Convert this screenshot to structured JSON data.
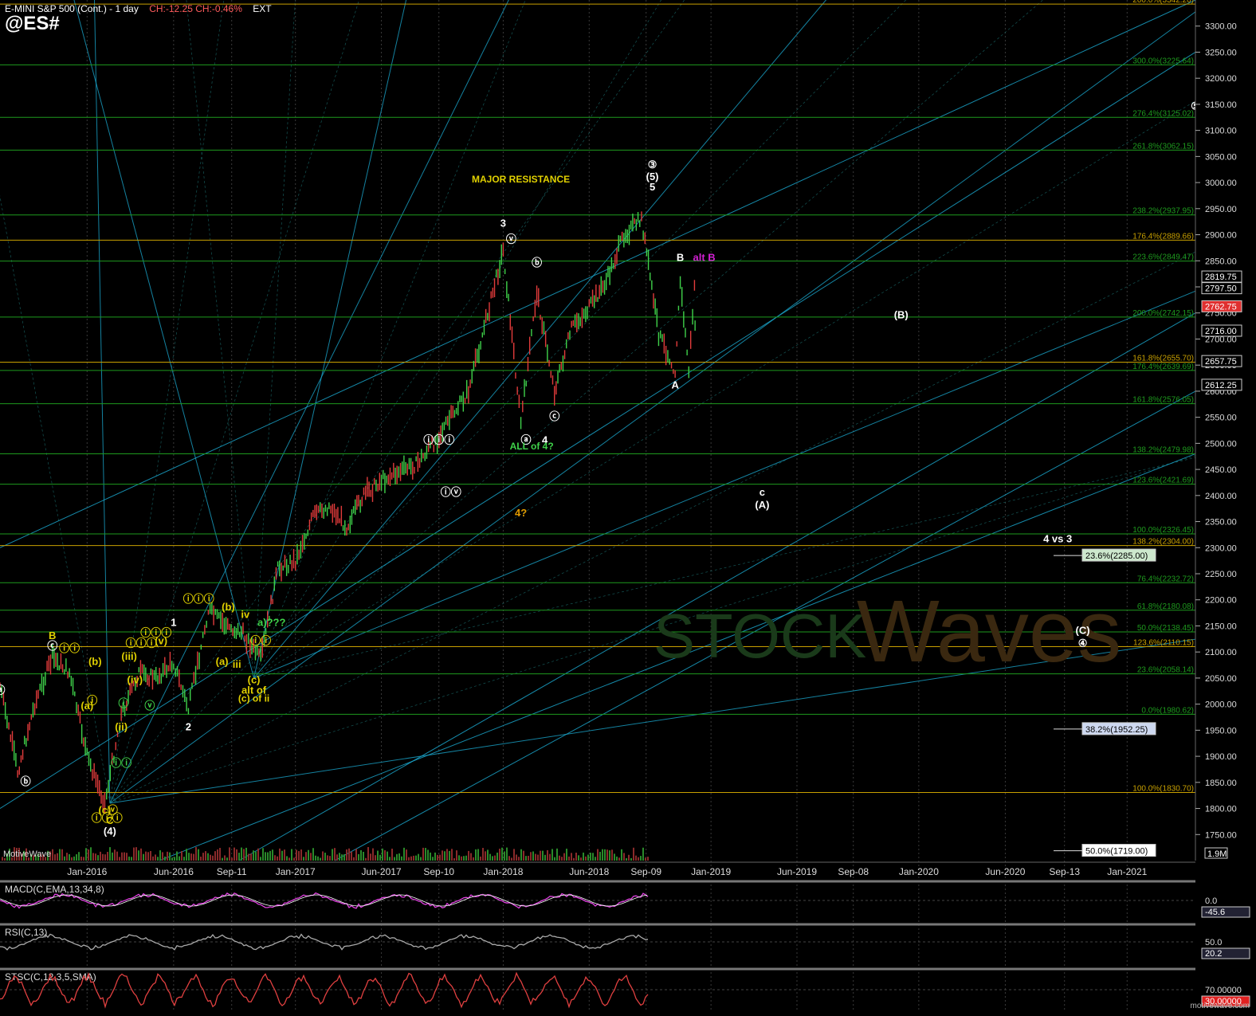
{
  "header": {
    "title": "E-MINI S&P 500 (Cont.) - 1 day",
    "change": "CH:-12.25  CH:-0.46%",
    "ext": "EXT",
    "symbol": "@ES#"
  },
  "footer": {
    "vendor": "MotiveWave",
    "watermark_site": "motivewave.com"
  },
  "colors": {
    "background": "#000000",
    "grid": "#123812",
    "fib_green": "#1e9a1e",
    "fib_orange": "#c8a000",
    "fan_blue": "#1aa3c8",
    "up_candle": "#3fd24a",
    "down_candle": "#e23b3b"
  },
  "chart_data": {
    "type": "candlestick",
    "y_axis": {
      "ylim": [
        1700,
        3350
      ],
      "ticks": [
        3300,
        3250,
        3200,
        3150,
        3100,
        3050,
        3000,
        2950,
        2900,
        2850,
        2800,
        2750,
        2700,
        2650,
        2600,
        2550,
        2500,
        2450,
        2400,
        2350,
        2300,
        2250,
        2200,
        2150,
        2100,
        2050,
        2000,
        1950,
        1900,
        1850,
        1800,
        1750
      ]
    },
    "x_axis": {
      "ticks": [
        "Jan-2016",
        "Jun-2016",
        "Sep-11",
        "Jan-2017",
        "Jun-2017",
        "Sep-10",
        "Jan-2018",
        "Jun-2018",
        "Sep-09",
        "Jan-2019",
        "Jun-2019",
        "Sep-08",
        "Jan-2020",
        "Jun-2020",
        "Sep-13",
        "Jan-2021"
      ]
    },
    "price_path": [
      [
        "2015-08",
        2035
      ],
      [
        "2015-09",
        1870
      ],
      [
        "2015-10",
        2000
      ],
      [
        "2015-11",
        2090
      ],
      [
        "2015-12",
        2060
      ],
      [
        "2016-01",
        1900
      ],
      [
        "2016-02",
        1810
      ],
      [
        "2016-03",
        1980
      ],
      [
        "2016-04",
        2060
      ],
      [
        "2016-05",
        2050
      ],
      [
        "2016-06",
        2080
      ],
      [
        "2016-06-27",
        1990
      ],
      [
        "2016-08",
        2180
      ],
      [
        "2016-09",
        2150
      ],
      [
        "2016-10",
        2135
      ],
      [
        "2016-11",
        2085
      ],
      [
        "2016-12",
        2260
      ],
      [
        "2017-01",
        2275
      ],
      [
        "2017-02",
        2360
      ],
      [
        "2017-03",
        2380
      ],
      [
        "2017-04",
        2340
      ],
      [
        "2017-05",
        2400
      ],
      [
        "2017-06",
        2430
      ],
      [
        "2017-08",
        2460
      ],
      [
        "2017-09",
        2500
      ],
      [
        "2017-11",
        2600
      ],
      [
        "2018-01",
        2870
      ],
      [
        "2018-02",
        2540
      ],
      [
        "2018-03",
        2790
      ],
      [
        "2018-04",
        2600
      ],
      [
        "2018-05",
        2720
      ],
      [
        "2018-06",
        2760
      ],
      [
        "2018-07",
        2810
      ],
      [
        "2018-08",
        2900
      ],
      [
        "2018-09",
        2930
      ],
      [
        "2018-10",
        2710
      ],
      [
        "2018-10-30",
        2640
      ],
      [
        "2018-11-08",
        2810
      ],
      [
        "2018-11-23",
        2640
      ],
      [
        "2018-12-03",
        2800
      ],
      [
        "2018-12-05",
        2660
      ]
    ],
    "price_labels": [
      {
        "value": 2819.75,
        "bg": "#000000",
        "fg": "#ffffff"
      },
      {
        "value": 2797.5,
        "bg": "#000000",
        "fg": "#ffffff"
      },
      {
        "value": 2762.75,
        "bg": "#e03030",
        "fg": "#ffffff"
      },
      {
        "value": 2716.0,
        "bg": "#000000",
        "fg": "#ffffff"
      },
      {
        "value": 2657.75,
        "bg": "#000000",
        "fg": "#ffffff"
      },
      {
        "value": 2612.25,
        "bg": "#000000",
        "fg": "#ffffff"
      }
    ],
    "fib_levels": [
      {
        "label": "200.0%(3342.20)",
        "value": 3342.2,
        "color": "#c8a000"
      },
      {
        "label": "300.0%(3225.64)",
        "value": 3225.64,
        "color": "#1e9a1e"
      },
      {
        "label": "276.4%(3125.02)",
        "value": 3125.02,
        "color": "#1e9a1e"
      },
      {
        "label": "261.8%(3062.15)",
        "value": 3062.15,
        "color": "#1e9a1e"
      },
      {
        "label": "238.2%(2937.95)",
        "value": 2937.95,
        "color": "#1e9a1e"
      },
      {
        "label": "176.4%(2889.66)",
        "value": 2889.66,
        "color": "#c8a000"
      },
      {
        "label": "223.6%(2849.47)",
        "value": 2849.47,
        "color": "#1e9a1e"
      },
      {
        "label": "200.0%(2742.15)",
        "value": 2742.15,
        "color": "#1e9a1e"
      },
      {
        "label": "161.8%(2655.70)",
        "value": 2655.7,
        "color": "#c8a000"
      },
      {
        "label": "176.4%(2639.69)",
        "value": 2639.69,
        "color": "#1e9a1e"
      },
      {
        "label": "161.8%(2576.05)",
        "value": 2576.05,
        "color": "#1e9a1e"
      },
      {
        "label": "138.2%(2479.98)",
        "value": 2479.98,
        "color": "#1e9a1e"
      },
      {
        "label": "123.6%(2421.69)",
        "value": 2421.69,
        "color": "#1e9a1e"
      },
      {
        "label": "100.0%(2326.45)",
        "value": 2326.45,
        "color": "#1e9a1e"
      },
      {
        "label": "138.2%(2304.00)",
        "value": 2304.0,
        "color": "#c8a000"
      },
      {
        "label": "76.4%(2232.72)",
        "value": 2232.72,
        "color": "#1e9a1e"
      },
      {
        "label": "61.8%(2180.08)",
        "value": 2180.08,
        "color": "#1e9a1e"
      },
      {
        "label": "50.0%(2138.45)",
        "value": 2138.45,
        "color": "#1e9a1e"
      },
      {
        "label": "123.6%(2110.15)",
        "value": 2110.15,
        "color": "#c8a000"
      },
      {
        "label": "23.6%(2058.14)",
        "value": 2058.14,
        "color": "#1e9a1e"
      },
      {
        "label": "0.0%(1980.62)",
        "value": 1980.62,
        "color": "#1e9a1e"
      },
      {
        "label": "100.0%(1830.70)",
        "value": 1830.7,
        "color": "#c8a000"
      }
    ],
    "retracement_boxes": [
      {
        "label": "23.6%(2285.00)",
        "value": 2285.0,
        "bg": "#cde8cd"
      },
      {
        "label": "38.2%(1952.25)",
        "value": 1952.25,
        "bg": "#cdd8f0"
      },
      {
        "label": "50.0%(1719.00)",
        "value": 1719.0,
        "bg": "#ffffff"
      }
    ],
    "annotations": [
      {
        "text": "MAJOR RESISTANCE",
        "date": "2018-02",
        "price": 3000,
        "color": "#e0d000"
      },
      {
        "text": "3",
        "date": "2018-01",
        "price": 2915,
        "color": "#ffffff"
      },
      {
        "text": "5",
        "date": "2018-09-20",
        "price": 2985,
        "color": "#ffffff"
      },
      {
        "text": "(5)",
        "date": "2018-09-20",
        "price": 3005,
        "color": "#ffffff"
      },
      {
        "text": "③",
        "date": "2018-09-20",
        "price": 3028,
        "color": "#ffffff"
      },
      {
        "text": "B",
        "date": "2018-11-08",
        "price": 2850,
        "color": "#ffffff"
      },
      {
        "text": "alt B",
        "date": "2018-12-20",
        "price": 2850,
        "color": "#d020d0"
      },
      {
        "text": "A",
        "date": "2018-10-30",
        "price": 2605,
        "color": "#ffffff"
      },
      {
        "text": "(B)",
        "date": "2019-12-01",
        "price": 2740,
        "color": "#ffffff"
      },
      {
        "text": "c",
        "date": "2019-04-01",
        "price": 2400,
        "color": "#ffffff"
      },
      {
        "text": "(A)",
        "date": "2019-04-01",
        "price": 2375,
        "color": "#ffffff"
      },
      {
        "text": "4",
        "date": "2018-03-15",
        "price": 2500,
        "color": "#ffffff"
      },
      {
        "text": "ⓐ",
        "date": "2018-02-10",
        "price": 2500,
        "color": "#ffffff"
      },
      {
        "text": "ⓑ",
        "date": "2018-03-01",
        "price": 2840,
        "color": "#ffffff"
      },
      {
        "text": "ⓒ",
        "date": "2018-04-01",
        "price": 2545,
        "color": "#ffffff"
      },
      {
        "text": "ⓥ",
        "date": "2018-01-15",
        "price": 2885,
        "color": "#ffffff"
      },
      {
        "text": "ALL of 4?",
        "date": "2018-02-20",
        "price": 2488,
        "color": "#3fd24a"
      },
      {
        "text": "4?",
        "date": "2018-02-01",
        "price": 2360,
        "color": "#e09a00"
      },
      {
        "text": "4 vs 3",
        "date": "2020-09-01",
        "price": 2310,
        "color": "#ffffff"
      },
      {
        "text": "ⓘⓘⓘ",
        "date": "2017-09-10",
        "price": 2500,
        "color": "#ffffff"
      },
      {
        "text": "ⓘⓥ",
        "date": "2017-10-01",
        "price": 2400,
        "color": "#ffffff"
      },
      {
        "text": "(C)",
        "date": "2020-10-15",
        "price": 2135,
        "color": "#ffffff"
      },
      {
        "text": "④",
        "date": "2020-10-15",
        "price": 2110,
        "color": "#ffffff"
      },
      {
        "text": "⑤",
        "date": "2021-05-01",
        "price": 3140,
        "color": "#ffffff"
      },
      {
        "text": "1",
        "date": "2016-06-01",
        "price": 2150,
        "color": "#ffffff"
      },
      {
        "text": "2",
        "date": "2016-06-27",
        "price": 1950,
        "color": "#ffffff"
      },
      {
        "text": "B",
        "date": "2015-11-01",
        "price": 2125,
        "color": "#e0d000"
      },
      {
        "text": "ⓒ",
        "date": "2015-11-01",
        "price": 2105,
        "color": "#ffffff"
      },
      {
        "text": "ⓘⓘ",
        "date": "2015-12-01",
        "price": 2100,
        "color": "#e0d000"
      },
      {
        "text": "ⓐ",
        "date": "2015-08-01",
        "price": 2020,
        "color": "#ffffff"
      },
      {
        "text": "ⓑ",
        "date": "2015-09-15",
        "price": 1845,
        "color": "#ffffff"
      },
      {
        "text": "(a)",
        "date": "2016-01-01",
        "price": 1990,
        "color": "#e0d000"
      },
      {
        "text": "(b)",
        "date": "2016-01-15",
        "price": 2075,
        "color": "#e0d000"
      },
      {
        "text": "C",
        "date": "2016-02-10",
        "price": 1770,
        "color": "#e0d000"
      },
      {
        "text": "(4)",
        "date": "2016-02-10",
        "price": 1750,
        "color": "#ffffff"
      },
      {
        "text": "ⓘⓘⓘ",
        "date": "2016-02-05",
        "price": 1775,
        "color": "#e0d000"
      },
      {
        "text": "ⓥ",
        "date": "2016-02-15",
        "price": 1790,
        "color": "#e0d000"
      },
      {
        "text": "(c)",
        "date": "2016-02-01",
        "price": 1790,
        "color": "#e0d000"
      },
      {
        "text": "ⓘ",
        "date": "2016-01-10",
        "price": 2000,
        "color": "#e0d000"
      },
      {
        "text": "ⓘⓘⓘ",
        "date": "2016-04-05",
        "price": 2110,
        "color": "#e0d000"
      },
      {
        "text": "ⓥ",
        "date": "2016-04-20",
        "price": 1990,
        "color": "#3fd24a"
      },
      {
        "text": "(iv)",
        "date": "2016-03-25",
        "price": 2040,
        "color": "#e0d000"
      },
      {
        "text": "(iii)",
        "date": "2016-03-15",
        "price": 2085,
        "color": "#e0d000"
      },
      {
        "text": "(ii)",
        "date": "2016-03-01",
        "price": 1950,
        "color": "#e0d000"
      },
      {
        "text": "ⓘⓘ",
        "date": "2016-03-01",
        "price": 1880,
        "color": "#3fd24a"
      },
      {
        "text": "ⓘ",
        "date": "2016-03-05",
        "price": 1995,
        "color": "#3fd24a"
      },
      {
        "text": "ⓘⓘⓘ",
        "date": "2016-05-01",
        "price": 2130,
        "color": "#e0d000"
      },
      {
        "text": "(v)",
        "date": "2016-05-10",
        "price": 2115,
        "color": "#e0d000"
      },
      {
        "text": "ⓘⓘⓘ",
        "date": "2016-07-15",
        "price": 2195,
        "color": "#e0d000"
      },
      {
        "text": "(b)",
        "date": "2016-09-05",
        "price": 2180,
        "color": "#e0d000"
      },
      {
        "text": "(a)",
        "date": "2016-08-25",
        "price": 2075,
        "color": "#e0d000"
      },
      {
        "text": "iv",
        "date": "2016-10-05",
        "price": 2165,
        "color": "#e0d000"
      },
      {
        "text": "iii",
        "date": "2016-09-20",
        "price": 2070,
        "color": "#e0d000"
      },
      {
        "text": "(c)",
        "date": "2016-10-20",
        "price": 2040,
        "color": "#e0d000"
      },
      {
        "text": "alt of",
        "date": "2016-10-20",
        "price": 2020,
        "color": "#e0d000"
      },
      {
        "text": "(c) of ii",
        "date": "2016-10-20",
        "price": 2005,
        "color": "#e0d000"
      },
      {
        "text": "ⓘⓘ",
        "date": "2016-11-01",
        "price": 2115,
        "color": "#e0d000"
      },
      {
        "text": "a)???",
        "date": "2016-11-20",
        "price": 2150,
        "color": "#3fd24a"
      }
    ],
    "volume_label": "1.9M",
    "indicators": [
      {
        "name": "MACD(C,EMA,13,34,8)",
        "readout_top": "0.0",
        "readout_value": "-45.6",
        "line_color": "#e040e0",
        "signal_color": "#ffffff"
      },
      {
        "name": "RSI(C,13)",
        "readout_top": "50.0",
        "readout_value": "20.2",
        "line_color": "#aaaaaa"
      },
      {
        "name": "STSC(C,12,3,5,SMA)",
        "readout_top": "70.00000",
        "readout_value": "30.00000",
        "line_color": "#e04040"
      }
    ]
  }
}
